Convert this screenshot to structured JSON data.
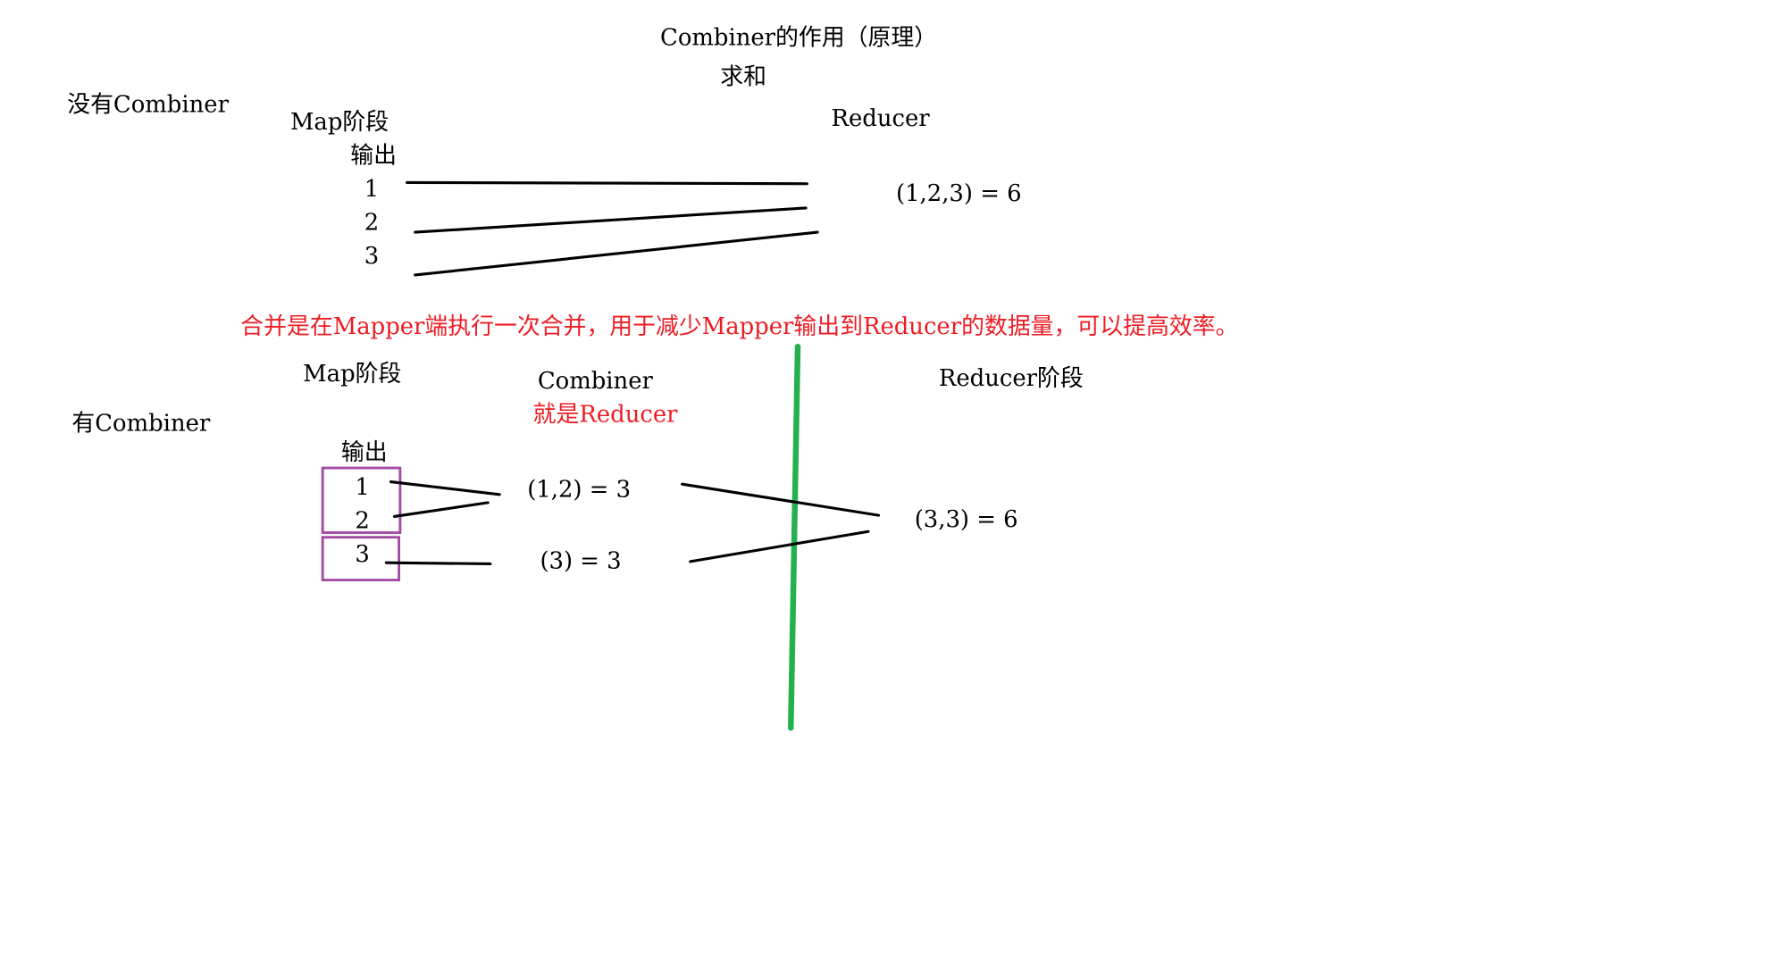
{
  "title": "Combiner的作用（原理）",
  "subtitle": "求和",
  "without": {
    "label": "没有Combiner",
    "map_stage": "Map阶段",
    "output": "输出",
    "values": [
      "1",
      "2",
      "3"
    ],
    "reducer": "Reducer",
    "result": "(1,2,3) = 6"
  },
  "note": "合并是在Mapper端执行一次合并，用于减少Mapper输出到Reducer的数据量，可以提高效率。",
  "with": {
    "label": "有Combiner",
    "map_stage": "Map阶段",
    "combiner": "Combiner",
    "combiner_note": "就是Reducer",
    "reducer_stage": "Reducer阶段",
    "output": "输出",
    "values": [
      "1",
      "2",
      "3"
    ],
    "combine_1": "(1,2) = 3",
    "combine_2": "(3) = 3",
    "result": "(3,3) = 6"
  },
  "colors": {
    "note": "#ed1c24",
    "box": "#a349a4",
    "divider": "#22b14c",
    "lines": "#000000"
  }
}
